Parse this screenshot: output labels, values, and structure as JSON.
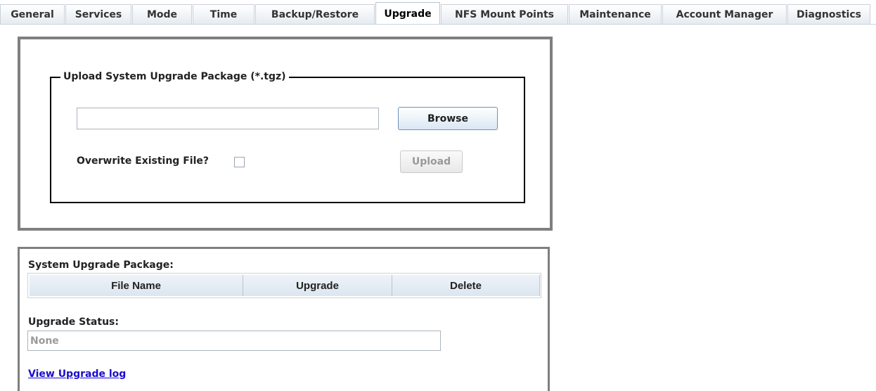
{
  "tabs": [
    {
      "label": "General"
    },
    {
      "label": "Services"
    },
    {
      "label": "Mode"
    },
    {
      "label": "Time"
    },
    {
      "label": "Backup/Restore"
    },
    {
      "label": "Upgrade",
      "active": true
    },
    {
      "label": "NFS Mount Points"
    },
    {
      "label": "Maintenance"
    },
    {
      "label": "Account Manager"
    },
    {
      "label": "Diagnostics"
    }
  ],
  "upload": {
    "legend": "Upload System Upgrade Package (*.tgz)",
    "file_value": "",
    "browse_label": "Browse",
    "overwrite_label": "Overwrite Existing File?",
    "overwrite_checked": false,
    "upload_label": "Upload"
  },
  "package": {
    "label": "System Upgrade Package:",
    "columns": [
      "File Name",
      "Upgrade",
      "Delete"
    ],
    "rows": [],
    "status_label": "Upgrade Status:",
    "status_value": "None",
    "log_link": "View Upgrade log"
  },
  "colors": {
    "link": "#1a0dcc",
    "frame_border": "#7f7f7f",
    "disabled_text": "#999999"
  }
}
